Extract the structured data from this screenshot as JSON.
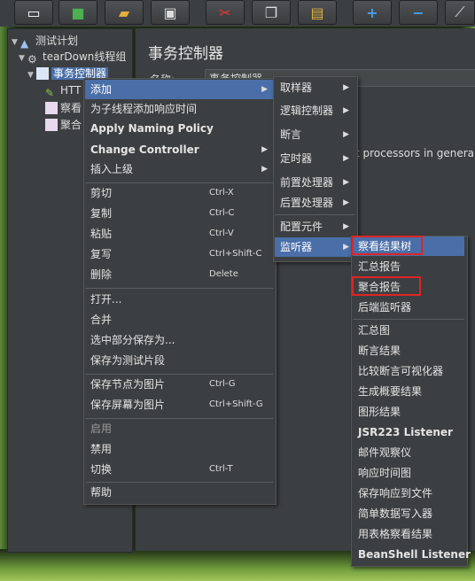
{
  "tree": {
    "items": [
      {
        "label": "测试计划"
      },
      {
        "label": "tearDown线程组"
      },
      {
        "label": "事务控制器"
      },
      {
        "label": "HTT"
      },
      {
        "label": "察看"
      },
      {
        "label": "聚合"
      }
    ]
  },
  "main": {
    "title": "事务控制器",
    "name_label": "名称:",
    "name_value": "事务控制器",
    "body_text": "t processors in genera"
  },
  "menu1": {
    "add": "添加",
    "add_think_time": "为子线程添加响应时间",
    "apply_naming": "Apply Naming Policy",
    "change_controller": "Change Controller",
    "insert_parent": "插入上级",
    "cut": "剪切",
    "cut_key": "Ctrl-X",
    "copy": "复制",
    "copy_key": "Ctrl-C",
    "paste": "粘贴",
    "paste_key": "Ctrl-V",
    "duplicate": "复写",
    "duplicate_key": "Ctrl+Shift-C",
    "delete": "删除",
    "delete_key": "Delete",
    "open": "打开...",
    "merge": "合并",
    "save_selection": "选中部分保存为...",
    "save_fragment": "保存为测试片段",
    "save_node_image": "保存节点为图片",
    "save_node_image_key": "Ctrl-G",
    "save_screen_image": "保存屏幕为图片",
    "save_screen_image_key": "Ctrl+Shift-G",
    "enable": "启用",
    "disable": "禁用",
    "toggle": "切换",
    "toggle_key": "Ctrl-T",
    "help": "帮助"
  },
  "menu2": {
    "items": [
      "取样器",
      "逻辑控制器",
      "断言",
      "定时器",
      "前置处理器",
      "后置处理器",
      "配置元件",
      "监听器"
    ]
  },
  "menu3": {
    "items": [
      "察看结果树",
      "汇总报告",
      "聚合报告",
      "后端监听器",
      "汇总图",
      "断言结果",
      "比较断言可视化器",
      "生成概要结果",
      "图形结果",
      "JSR223 Listener",
      "邮件观察仪",
      "响应时间图",
      "保存响应到文件",
      "简单数据写入器",
      "用表格察看结果",
      "BeanShell Listener"
    ]
  },
  "colors": {
    "highlight": "#4a6ea8",
    "annotation_box": "#e02424"
  }
}
